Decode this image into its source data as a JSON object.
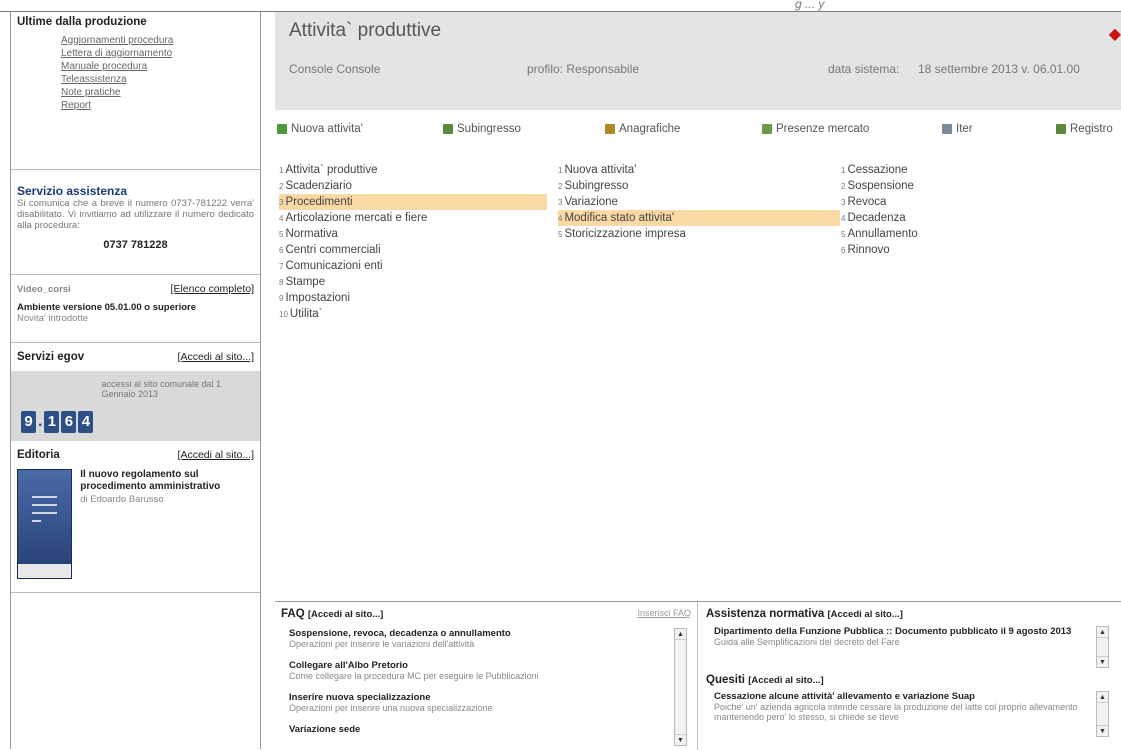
{
  "top_strip": "g   ...   y",
  "sidebar": {
    "news_title": "Ultime dalla produzione",
    "news_links": [
      "Aggiornamenti procedura",
      "Lettera di aggiornamento",
      "Manuale procedura",
      "Teleassistenza",
      "Note pratiche",
      "Report"
    ],
    "assist_title": "Servizio assistenza",
    "assist_text": "Si comunica che a breve il numero 0737-781222 verra' disabilitato. Vi invitiamo ad utilizzare il numero dedicato alla procedura:",
    "assist_phone": "0737 781228",
    "video_title": "Video_corsi",
    "video_link": "[Elenco completo]",
    "video_item": "Ambiente versione 05.01.00 o superiore",
    "video_sub": "Novita' introdotte",
    "egov_title": "Servizi egov",
    "egov_link": "[Accedi al sito...]",
    "egov_digits": [
      "9",
      "1",
      "6",
      "4"
    ],
    "egov_note": "accessi al sito comunale dal 1 Gennaio 2013",
    "edit_title": "Editoria",
    "edit_link": "[Accedi al sito...]",
    "edit_book": "Il nuovo regolamento sul procedimento amministrativo",
    "edit_author": "di Edoardo Barusso"
  },
  "header": {
    "title": "Attivita` produttive",
    "console": "Console Console",
    "profile": "profilo: Responsabile",
    "date_label": "data sistema:",
    "date_value": "18 settembre 2013 v. 06.01.00"
  },
  "toolbar": {
    "items": [
      "Nuova attivita'",
      "Subingresso",
      "Anagrafiche",
      "Presenze mercato",
      "Iter",
      "Registro"
    ],
    "colors": [
      "#4a9a3a",
      "#5a8a3a",
      "#b08a20",
      "#6a9a4a",
      "#7a8a9a",
      "#5a8a3a"
    ]
  },
  "menu1": [
    {
      "n": "1",
      "label": "Attivita` produttive"
    },
    {
      "n": "2",
      "label": "Scadenziario"
    },
    {
      "n": "3",
      "label": "Procedimenti"
    },
    {
      "n": "4",
      "label": "Articolazione mercati e fiere"
    },
    {
      "n": "5",
      "label": "Normativa"
    },
    {
      "n": "6",
      "label": "Centri commerciali"
    },
    {
      "n": "7",
      "label": "Comunicazioni enti"
    },
    {
      "n": "8",
      "label": "Stampe"
    },
    {
      "n": "9",
      "label": "Impostazioni"
    },
    {
      "n": "10",
      "label": "Utilita`"
    }
  ],
  "menu2": [
    {
      "n": "1",
      "label": "Nuova attivita'"
    },
    {
      "n": "2",
      "label": "Subingresso"
    },
    {
      "n": "3",
      "label": "Variazione"
    },
    {
      "n": "4",
      "label": "Modifica stato attivita'"
    },
    {
      "n": "5",
      "label": "Storicizzazione impresa"
    }
  ],
  "menu3": [
    {
      "n": "1",
      "label": "Cessazione"
    },
    {
      "n": "2",
      "label": "Sospensione"
    },
    {
      "n": "3",
      "label": "Revoca"
    },
    {
      "n": "4",
      "label": "Decadenza"
    },
    {
      "n": "5",
      "label": "Annullamento"
    },
    {
      "n": "6",
      "label": "Rinnovo"
    }
  ],
  "highlight_color": "#fbd9a4",
  "faq": {
    "title": "FAQ",
    "link": "[Accedi al sito...]",
    "right_link": "Inserisci FAQ",
    "items": [
      {
        "t": "Sospensione, revoca, decadenza o annullamento",
        "d": "Operazioni per inserire le variazioni dell'attività"
      },
      {
        "t": "Collegare all'Albo Pretorio",
        "d": "Come collegare la procedura MC per eseguire le Pubblicazioni"
      },
      {
        "t": "Inserire nuova specializzazione",
        "d": "Operazioni per inserire una nuova specializzazione"
      },
      {
        "t": "Variazione sede",
        "d": ""
      }
    ]
  },
  "normativa": {
    "title": "Assistenza normativa",
    "link": "[Accedi al sito...]",
    "item_t": "Dipartimento della Funzione Pubblica :: Documento pubblicato il 9 agosto 2013",
    "item_d": "Guida alle Semplificazioni del decreto del Fare",
    "quesiti_title": "Quesiti",
    "quesiti_link": "[Accedi al sito...]",
    "q_t": "Cessazione alcune attività' allevamento e variazione Suap",
    "q_d": "Poiche' un' azienda agricola intende cessare la produzione del latte col proprio allevamento mantenendo pero' lo stesso, si chiede se deve"
  }
}
